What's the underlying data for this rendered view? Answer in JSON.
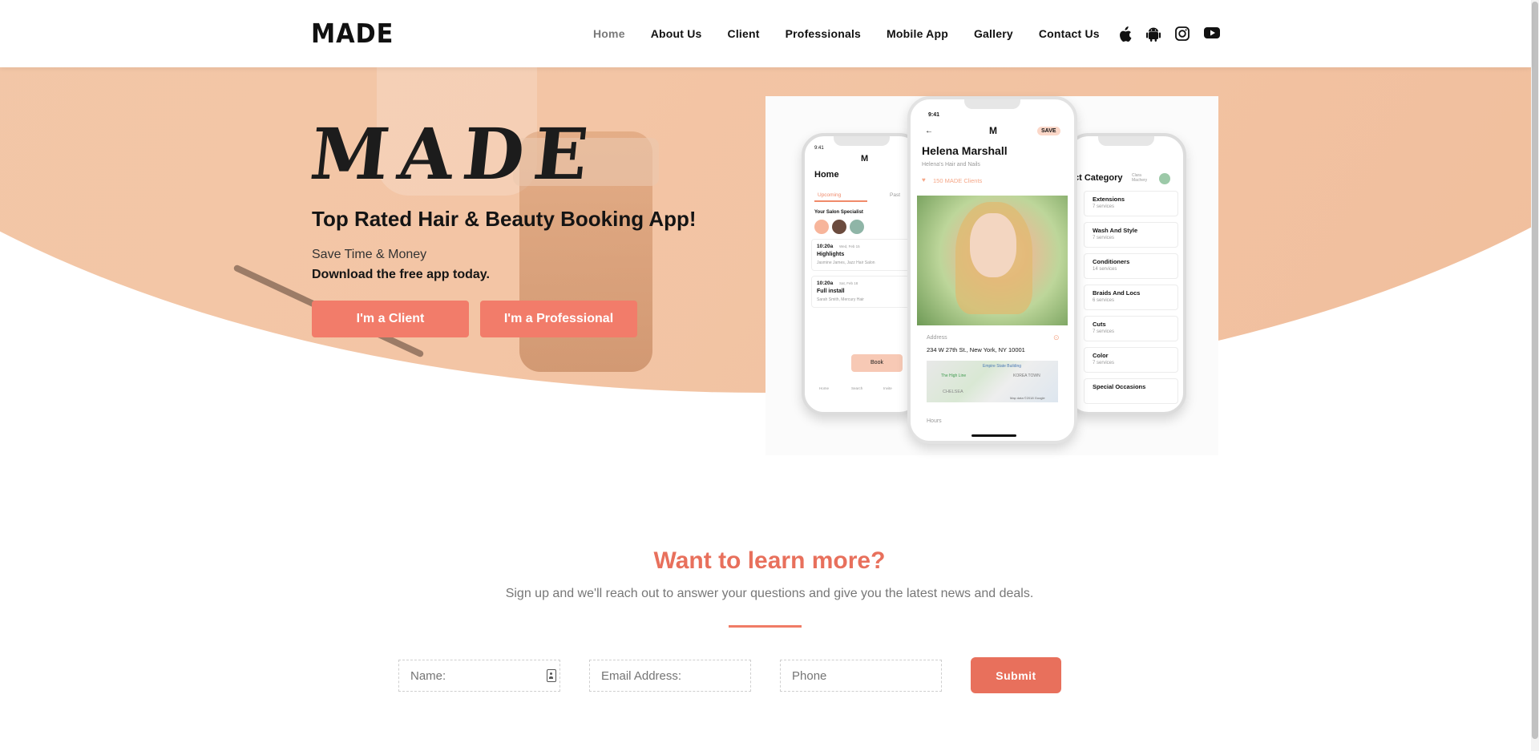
{
  "header": {
    "logo": "MADE",
    "nav": [
      {
        "label": "Home",
        "active": true
      },
      {
        "label": "About Us",
        "active": false
      },
      {
        "label": "Client",
        "active": false
      },
      {
        "label": "Professionals",
        "active": false
      },
      {
        "label": "Mobile App",
        "active": false
      },
      {
        "label": "Gallery",
        "active": false
      },
      {
        "label": "Contact Us",
        "active": false
      }
    ],
    "social_icons": [
      "apple-icon",
      "android-icon",
      "instagram-icon",
      "youtube-icon"
    ]
  },
  "hero": {
    "brand_mark": "MADE",
    "tagline": "Top Rated Hair & Beauty Booking App!",
    "subtitle": "Save Time & Money",
    "cta_text": "Download the free app today.",
    "btn_client": "I'm a Client",
    "btn_professional": "I'm a Professional",
    "colors": {
      "accent": "#f27c6a",
      "hero_bg": "#f3c5a5"
    }
  },
  "phones": {
    "left": {
      "time": "9:41",
      "title": "Home",
      "tabs": [
        "Upcoming",
        "Past"
      ],
      "section": "Your Salon Specialist",
      "appointments": [
        {
          "time": "10:20a",
          "date": "Wed, Feb 15",
          "title": "Highlights",
          "detail": "Jasmine James, Jazz Hair Salon"
        },
        {
          "time": "10:20a",
          "date": "Sat, Feb 18",
          "title": "Full install",
          "detail": "Sarah Smith, Mercury Hair"
        }
      ],
      "book_label": "Book",
      "bottom_nav": [
        "Home",
        "Search",
        "Invite"
      ]
    },
    "center": {
      "time": "9:41",
      "save_label": "SAVE",
      "name": "Helena Marshall",
      "business": "Helena's Hair and Nails",
      "clients": "150 MADE Clients",
      "address_label": "Address",
      "address": "234 W 27th St., New York, NY 10001",
      "map_labels": [
        "Empire State Building",
        "The High Line",
        "KOREA TOWN",
        "CHELSEA",
        "Map data ©2018 Google"
      ],
      "hours_label": "Hours"
    },
    "right": {
      "title": "ct Category",
      "user": "Clara Machery",
      "categories": [
        {
          "name": "Extensions",
          "count": "7 services"
        },
        {
          "name": "Wash And Style",
          "count": "7 services"
        },
        {
          "name": "Conditioners",
          "count": "14 services"
        },
        {
          "name": "Braids And Locs",
          "count": "6 services"
        },
        {
          "name": "Cuts",
          "count": "7 services"
        },
        {
          "name": "Color",
          "count": "7 services"
        },
        {
          "name": "Special Occasions",
          "count": ""
        }
      ]
    }
  },
  "signup": {
    "title": "Want to learn more?",
    "subtitle": "Sign up and we'll reach out to answer your questions and give you the latest news and deals.",
    "name_placeholder": "Name:",
    "email_placeholder": "Email Address:",
    "phone_placeholder": "Phone",
    "submit_label": "Submit"
  }
}
